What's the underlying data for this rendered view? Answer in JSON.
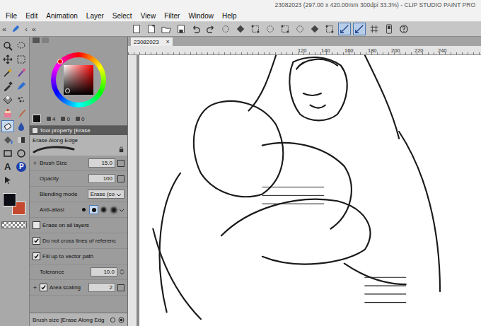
{
  "window": {
    "title": "23082023 (297.00 x 420.00mm 300dpi 33.3%) - CLIP STUDIO PAINT PRO"
  },
  "menu": [
    "File",
    "Edit",
    "Animation",
    "Layer",
    "Select",
    "View",
    "Filter",
    "Window",
    "Help"
  ],
  "panel_header": {
    "collapse_left": "«",
    "collapse_panel": "‹",
    "collapse_right": "«"
  },
  "toolbar": [
    {
      "kind": "canvas",
      "selected": false
    },
    {
      "kind": "new",
      "selected": false
    },
    {
      "kind": "open",
      "selected": false
    },
    {
      "kind": "save",
      "selected": false
    },
    {
      "kind": "undo",
      "selected": false
    },
    {
      "kind": "redo",
      "selected": false
    },
    {
      "kind": "clear",
      "selected": false
    },
    {
      "kind": "fill",
      "selected": false
    },
    {
      "kind": "transform",
      "selected": false
    },
    {
      "kind": "deselect",
      "selected": false
    },
    {
      "kind": "crop",
      "selected": false
    },
    {
      "kind": "invert",
      "selected": false
    },
    {
      "kind": "border",
      "selected": false
    },
    {
      "kind": "show-area",
      "selected": false
    },
    {
      "kind": "snap-ruler",
      "selected": true
    },
    {
      "kind": "snap-special",
      "selected": true
    },
    {
      "kind": "snap-grid",
      "selected": false
    },
    {
      "kind": "device",
      "selected": false
    },
    {
      "kind": "help",
      "selected": false
    }
  ],
  "canvas_tab": {
    "label": "23082023",
    "close": "×",
    "selected": true
  },
  "ruler": [
    "120",
    "140",
    "160",
    "180",
    "200",
    "220",
    "240"
  ],
  "tools": [
    {
      "kind": "zoom",
      "selected": false
    },
    {
      "kind": "lasso",
      "selected": false
    },
    {
      "kind": "move",
      "selected": false
    },
    {
      "kind": "select",
      "selected": false
    },
    {
      "kind": "wand",
      "selected": false
    },
    {
      "kind": "magic",
      "selected": false
    },
    {
      "kind": "eyedrop",
      "selected": false
    },
    {
      "kind": "pen",
      "selected": false
    },
    {
      "kind": "pencil",
      "selected": false
    },
    {
      "kind": "airbrush",
      "selected": false
    },
    {
      "kind": "deco",
      "selected": false
    },
    {
      "kind": "brush",
      "selected": false
    },
    {
      "kind": "eraser",
      "selected": true
    },
    {
      "kind": "blend",
      "selected": false
    },
    {
      "kind": "fill",
      "selected": false
    },
    {
      "kind": "gradient",
      "selected": false
    },
    {
      "kind": "figure",
      "selected": false
    },
    {
      "kind": "frame",
      "selected": false
    },
    {
      "kind": "text",
      "glyph": "A",
      "selected": false
    },
    {
      "kind": "balloon",
      "glyph": "P",
      "selected": false
    },
    {
      "kind": "correct",
      "selected": false
    }
  ],
  "swatches": [
    {
      "color": "#0d0d16",
      "selected": true
    },
    {
      "color": "#c4492e",
      "selected": false
    }
  ],
  "color_panel": {
    "readouts": [
      "4",
      "0",
      "0"
    ]
  },
  "tool_property": {
    "header": "Tool property [Erase",
    "tool_name": "Erase Along Edge",
    "rows": [
      {
        "kind": "field",
        "label": "Brush Size",
        "value": "15.0",
        "expander": "+"
      },
      {
        "kind": "field",
        "label": "Opacity",
        "value": "100"
      },
      {
        "kind": "select",
        "label": "Blending mode",
        "value": "Erase (co"
      },
      {
        "kind": "antialias",
        "label": "Anti-aliasi",
        "options": [
          {
            "selected": false
          },
          {
            "selected": true
          },
          {
            "selected": false
          },
          {
            "selected": false
          }
        ]
      },
      {
        "kind": "checkbox",
        "label": "Erase on all layers",
        "checked": false
      },
      {
        "kind": "checkbox",
        "label": "Do not cross lines of referenc",
        "checked": true
      },
      {
        "kind": "checkbox",
        "label": "Fill up to vector path",
        "checked": true
      },
      {
        "kind": "spin",
        "label": "Tolerance",
        "value": "10.0"
      },
      {
        "kind": "checkfield",
        "label": "Area scaling",
        "value": "2",
        "checked": true,
        "expander": "+"
      }
    ],
    "footer": "Brush size [Erase Along Edg"
  }
}
